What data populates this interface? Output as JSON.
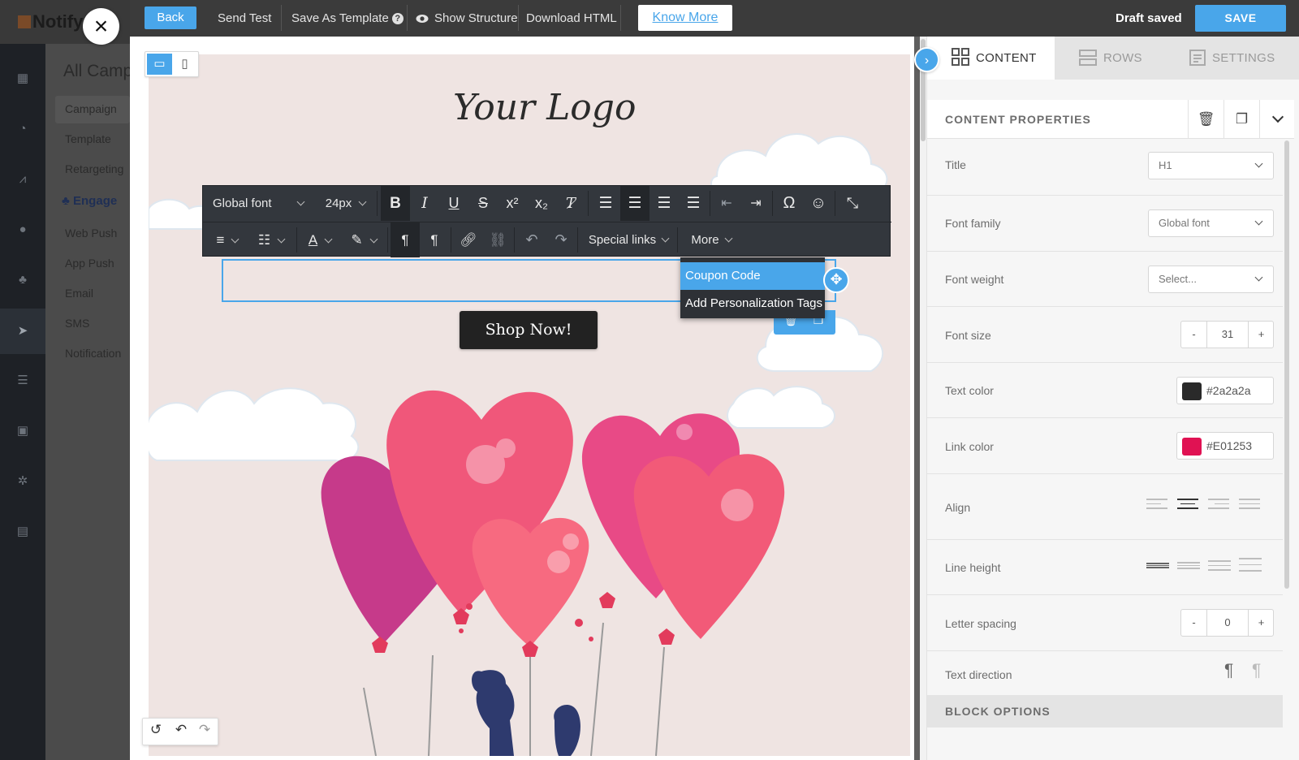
{
  "background_app": {
    "brand": "Notify",
    "heading": "All Camp",
    "menu": [
      "Campaign",
      "Template",
      "Retargeting",
      "Engage",
      "Web Push",
      "App Push",
      "Email",
      "SMS",
      "Notification"
    ]
  },
  "topbar": {
    "back": "Back",
    "send_test": "Send Test",
    "save_as_template": "Save As Template",
    "help_glyph": "?",
    "show_structure": "Show Structure",
    "download_html": "Download HTML",
    "know_more": "Know More",
    "status": "Draft saved",
    "save": "SAVE"
  },
  "canvas": {
    "logo_text": "Your Logo",
    "button_text": "Shop Now!",
    "accent_color": "#49a6ea",
    "background_color": "#efe4e2"
  },
  "editor_toolbar": {
    "font": "Global font",
    "size": "24px",
    "special_links": "Special links",
    "more": "More",
    "row1_icons": [
      "bold-icon",
      "italic-icon",
      "underline-icon",
      "strikethrough-icon",
      "superscript-icon",
      "subscript-icon",
      "clear-format-icon",
      "align-left-icon",
      "align-center-icon",
      "align-right-icon",
      "align-justify-icon",
      "outdent-icon",
      "indent-icon",
      "special-char-icon",
      "emoji-icon",
      "collapse-icon"
    ],
    "row2_icons": [
      "ordered-list-icon",
      "unordered-list-icon",
      "text-color-icon",
      "highlight-icon",
      "ltr-icon",
      "rtl-icon",
      "link-icon",
      "unlink-icon",
      "undo-icon",
      "redo-icon"
    ]
  },
  "special_links_menu": {
    "items": [
      "Coupon Code",
      "Add Personalization Tags"
    ],
    "highlighted": "Coupon Code"
  },
  "right_panel": {
    "tabs": [
      "CONTENT",
      "ROWS",
      "SETTINGS"
    ],
    "active_tab": "CONTENT",
    "section_title": "CONTENT PROPERTIES",
    "props": {
      "title_label": "Title",
      "title_value": "H1",
      "font_family_label": "Font family",
      "font_family_value": "Global font",
      "font_weight_label": "Font weight",
      "font_weight_value": "Select...",
      "font_size_label": "Font size",
      "font_size_value": "31",
      "text_color_label": "Text color",
      "text_color_value": "#2a2a2a",
      "link_color_label": "Link color",
      "link_color_value": "#E01253",
      "align_label": "Align",
      "line_height_label": "Line height",
      "letter_spacing_label": "Letter spacing",
      "letter_spacing_value": "0",
      "text_direction_label": "Text direction",
      "minus": "-",
      "plus": "+"
    },
    "block_options": "BLOCK OPTIONS"
  }
}
